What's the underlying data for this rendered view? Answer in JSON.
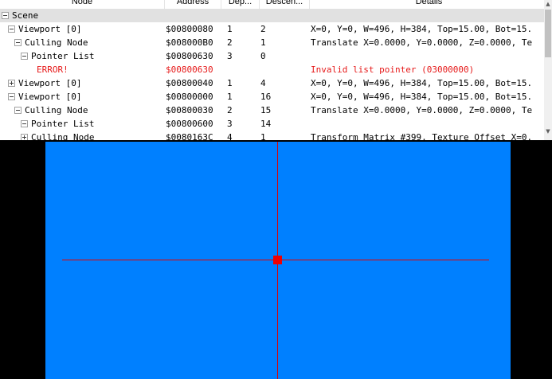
{
  "columns": [
    "Node",
    "Address",
    "Dep...",
    "Descen...",
    "Details"
  ],
  "rows": [
    {
      "name": "Scene",
      "address": "",
      "depth": "",
      "descendants": "",
      "details": "",
      "state": "minus",
      "selected": true,
      "error": false
    },
    {
      "name": "Viewport [0]",
      "address": "$00800080",
      "depth": "1",
      "descendants": "2",
      "details": "X=0, Y=0, W=496, H=384, Top=15.00, Bot=15.",
      "state": "minus",
      "selected": false,
      "error": false
    },
    {
      "name": "Culling Node",
      "address": "$008000B0",
      "depth": "2",
      "descendants": "1",
      "details": "Translate X=0.0000, Y=0.0000, Z=0.0000, Te",
      "state": "minus",
      "selected": false,
      "error": false
    },
    {
      "name": "Pointer List",
      "address": "$00800630",
      "depth": "3",
      "descendants": "0",
      "details": "",
      "state": "minus",
      "selected": false,
      "error": false
    },
    {
      "name": "ERROR!",
      "address": "$00800630",
      "depth": "",
      "descendants": "",
      "details": "Invalid list pointer (03000000)",
      "state": "none",
      "selected": false,
      "error": true
    },
    {
      "name": "Viewport [0]",
      "address": "$00800040",
      "depth": "1",
      "descendants": "4",
      "details": "X=0, Y=0, W=496, H=384, Top=15.00, Bot=15.",
      "state": "plus",
      "selected": false,
      "error": false
    },
    {
      "name": "Viewport [0]",
      "address": "$00800000",
      "depth": "1",
      "descendants": "16",
      "details": "X=0, Y=0, W=496, H=384, Top=15.00, Bot=15.",
      "state": "minus",
      "selected": false,
      "error": false
    },
    {
      "name": "Culling Node",
      "address": "$00800030",
      "depth": "2",
      "descendants": "15",
      "details": "Translate X=0.0000, Y=0.0000, Z=0.0000, Te",
      "state": "minus",
      "selected": false,
      "error": false
    },
    {
      "name": "Pointer List",
      "address": "$00800600",
      "depth": "3",
      "descendants": "14",
      "details": "",
      "state": "minus",
      "selected": false,
      "error": false
    },
    {
      "name": "Culling Node",
      "address": "$0080163C",
      "depth": "4",
      "descendants": "1",
      "details": "Transform Matrix #399, Texture Offset X=0.",
      "state": "plus",
      "selected": false,
      "error": false
    }
  ],
  "scrollbar": {
    "up_icon": "▲",
    "down_icon": "▼"
  },
  "colors": {
    "canvas": "#0080ff",
    "crosshair": "#e00000",
    "error_text": "#e61919",
    "selection": "#e1e1e1"
  }
}
